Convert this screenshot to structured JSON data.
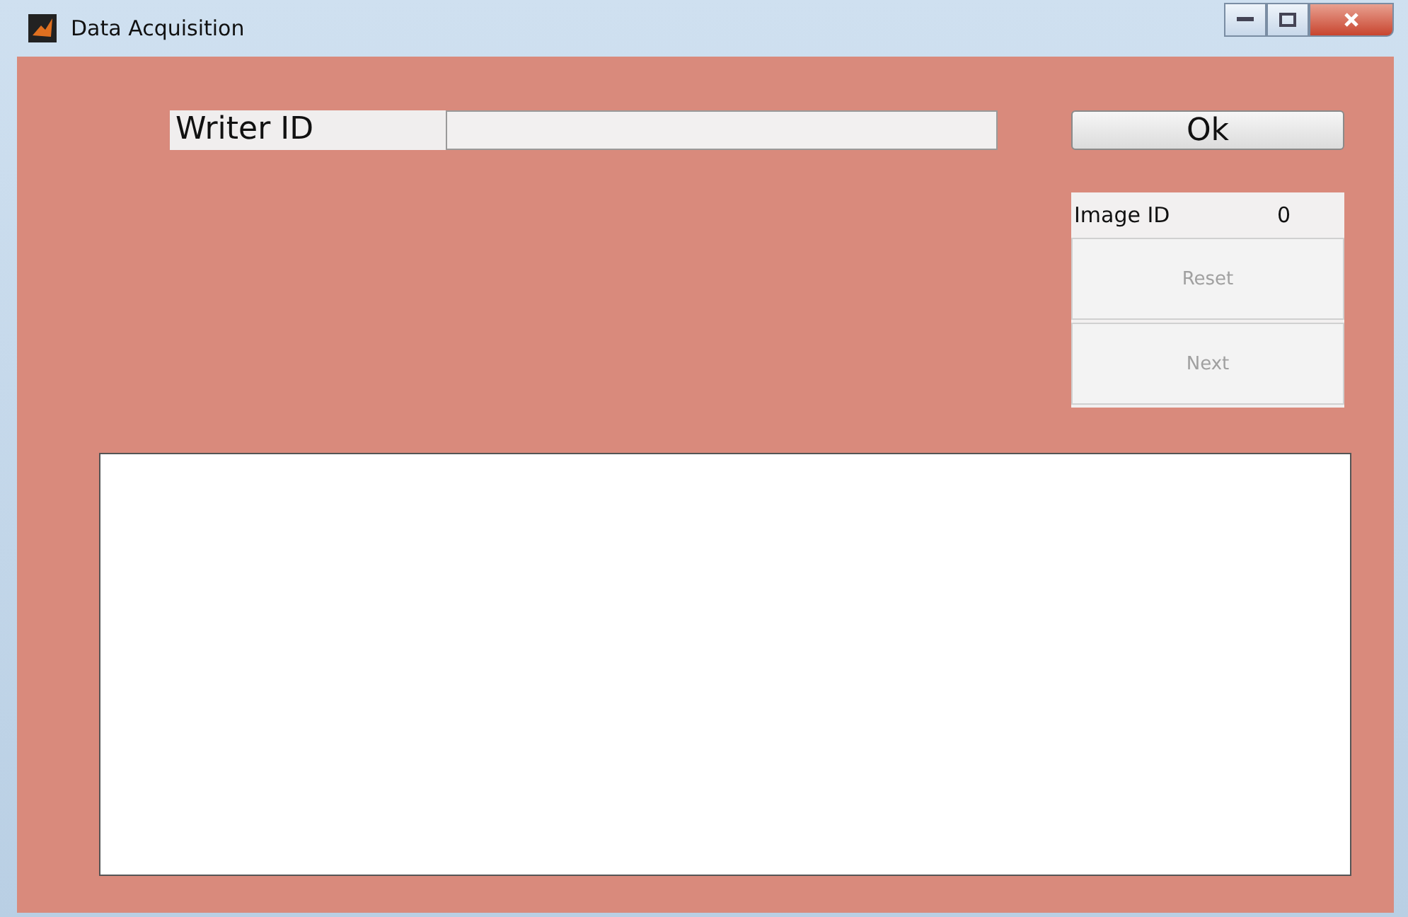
{
  "window": {
    "title": "Data Acquisition"
  },
  "writer_id": {
    "label": "Writer ID"
  },
  "ok_button": {
    "label": "Ok",
    "disabled": false
  },
  "image_id": {
    "label": "Image ID",
    "value": "0"
  },
  "buttons": [
    {
      "label": "Reset",
      "disabled": true
    },
    {
      "label": "Next",
      "disabled": true
    }
  ]
}
